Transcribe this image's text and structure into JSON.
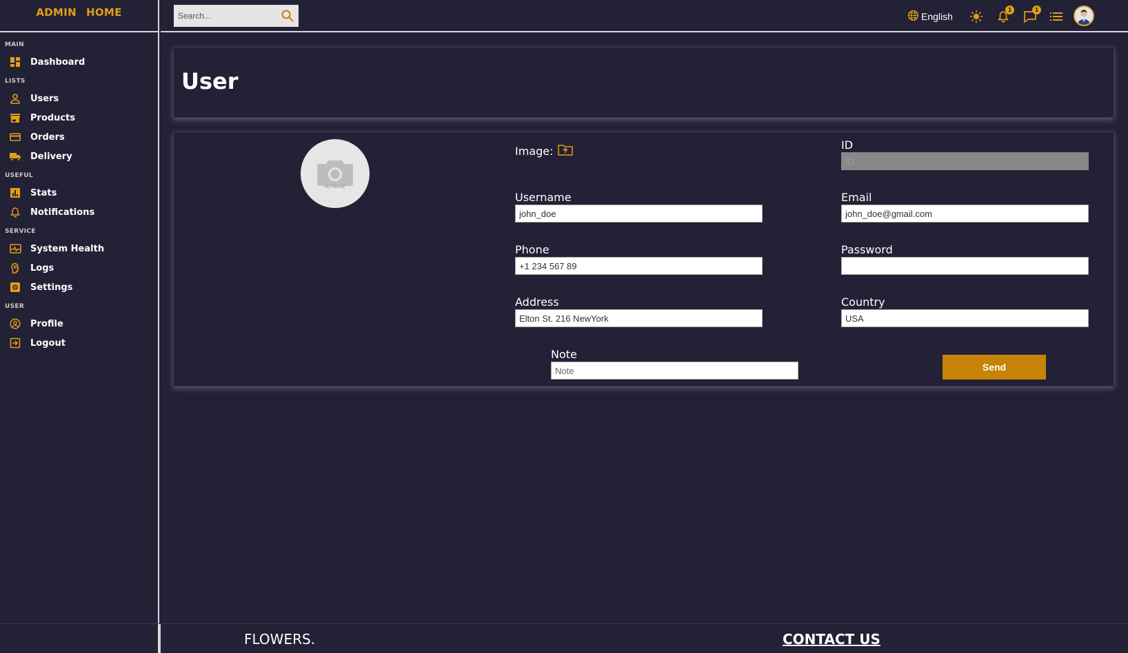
{
  "logo": {
    "admin": "ADMIN",
    "home": "HOME"
  },
  "colors": {
    "accent": "#e39e14",
    "background": "#222136",
    "button": "#c68308"
  },
  "sidebar": {
    "sections": [
      {
        "title": "MAIN",
        "items": [
          {
            "label": "Dashboard",
            "icon": "dashboard-icon"
          }
        ]
      },
      {
        "title": "LISTS",
        "items": [
          {
            "label": "Users",
            "icon": "user-icon"
          },
          {
            "label": "Products",
            "icon": "store-icon"
          },
          {
            "label": "Orders",
            "icon": "credit-card-icon"
          },
          {
            "label": "Delivery",
            "icon": "truck-icon"
          }
        ]
      },
      {
        "title": "USEFUL",
        "items": [
          {
            "label": "Stats",
            "icon": "chart-icon"
          },
          {
            "label": "Notifications",
            "icon": "bell-icon"
          }
        ]
      },
      {
        "title": "SERVICE",
        "items": [
          {
            "label": "System Health",
            "icon": "monitor-heart-icon"
          },
          {
            "label": "Logs",
            "icon": "psychology-icon"
          },
          {
            "label": "Settings",
            "icon": "settings-icon"
          }
        ]
      },
      {
        "title": "USER",
        "items": [
          {
            "label": "Profile",
            "icon": "account-circle-icon"
          },
          {
            "label": "Logout",
            "icon": "logout-icon"
          }
        ]
      }
    ]
  },
  "topbar": {
    "search_placeholder": "Search...",
    "language": "English",
    "notifications_count": "1",
    "messages_count": "1"
  },
  "page": {
    "title": "User"
  },
  "form": {
    "image_label": "Image:",
    "no_image_text": "NO IMAGE",
    "id": {
      "label": "ID",
      "placeholder": "ID..",
      "value": ""
    },
    "username": {
      "label": "Username",
      "value": "john_doe"
    },
    "email": {
      "label": "Email",
      "value": "john_doe@gmail.com"
    },
    "phone": {
      "label": "Phone",
      "value": "+1 234 567 89"
    },
    "password": {
      "label": "Password",
      "value": ""
    },
    "address": {
      "label": "Address",
      "value": "Elton St. 216 NewYork"
    },
    "country": {
      "label": "Country",
      "value": "USA"
    },
    "note": {
      "label": "Note",
      "placeholder": "Note",
      "value": ""
    },
    "send_label": "Send"
  },
  "footer": {
    "brand": "FLOWERS.",
    "contact": "CONTACT US"
  }
}
